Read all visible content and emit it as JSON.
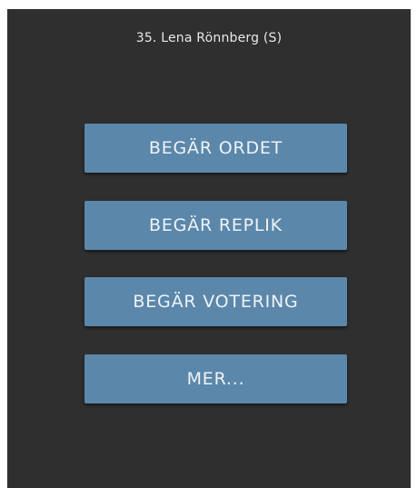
{
  "header": {
    "delegate": "35. Lena Rönnberg (S)"
  },
  "actions": [
    {
      "label": "BEGÄR ORDET"
    },
    {
      "label": "BEGÄR REPLIK"
    },
    {
      "label": "BEGÄR VOTERING"
    },
    {
      "label": "MER..."
    }
  ],
  "colors": {
    "background": "#2f2f2f",
    "button": "#5b87aa",
    "text": "#eef3f7"
  }
}
